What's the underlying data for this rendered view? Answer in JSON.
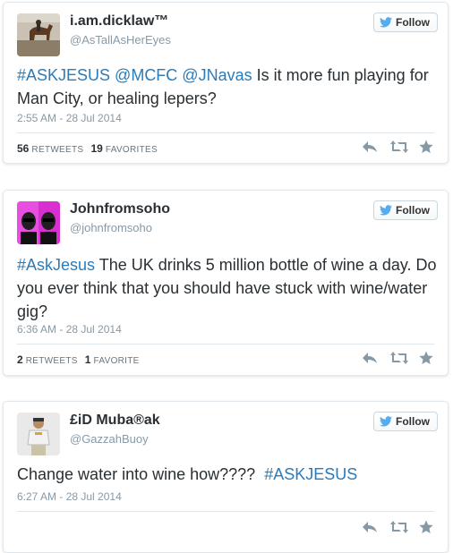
{
  "tweets": [
    {
      "name": "i.am.dicklaw™",
      "handle": "@AsTallAsHerEyes",
      "follow_label": "Follow",
      "text_parts": [
        {
          "t": "#ASKJESUS @MCFC @JNavas",
          "tag": true
        },
        {
          "t": " Is it more fun playing for Man City, or healing lepers?",
          "tag": false
        }
      ],
      "time": "2:55 AM - 28 Jul 2014",
      "retweets_count": "56",
      "retweets_label": "RETWEETS",
      "favorites_count": "19",
      "favorites_label": "FAVORITES"
    },
    {
      "name": "Johnfromsoho",
      "handle": "@johnfromsoho",
      "follow_label": "Follow",
      "text_parts": [
        {
          "t": "#AskJesus",
          "tag": true
        },
        {
          "t": " The UK drinks 5 million bottle of wine a day. Do you ever think that you should have stuck with wine/water gig?",
          "tag": false
        }
      ],
      "time": "6:36 AM - 28 Jul 2014",
      "retweets_count": "2",
      "retweets_label": "RETWEETS",
      "favorites_count": "1",
      "favorites_label": "FAVORITE"
    },
    {
      "name": "£iD Muba®ak",
      "handle": "@GazzahBuoy",
      "follow_label": "Follow",
      "text_parts": [
        {
          "t": "Change water into wine how????  ",
          "tag": false
        },
        {
          "t": "#ASKJESUS",
          "tag": true
        }
      ],
      "time": "6:27 AM - 28 Jul 2014"
    }
  ],
  "icons": {
    "follow": "twitter-bird-icon",
    "reply": "reply-icon",
    "retweet": "retweet-icon",
    "favorite": "star-icon"
  },
  "colors": {
    "link": "#2b7bb9",
    "follow_bird": "#55acee",
    "muted": "#8899a6",
    "action_icon": "#8899a6"
  }
}
